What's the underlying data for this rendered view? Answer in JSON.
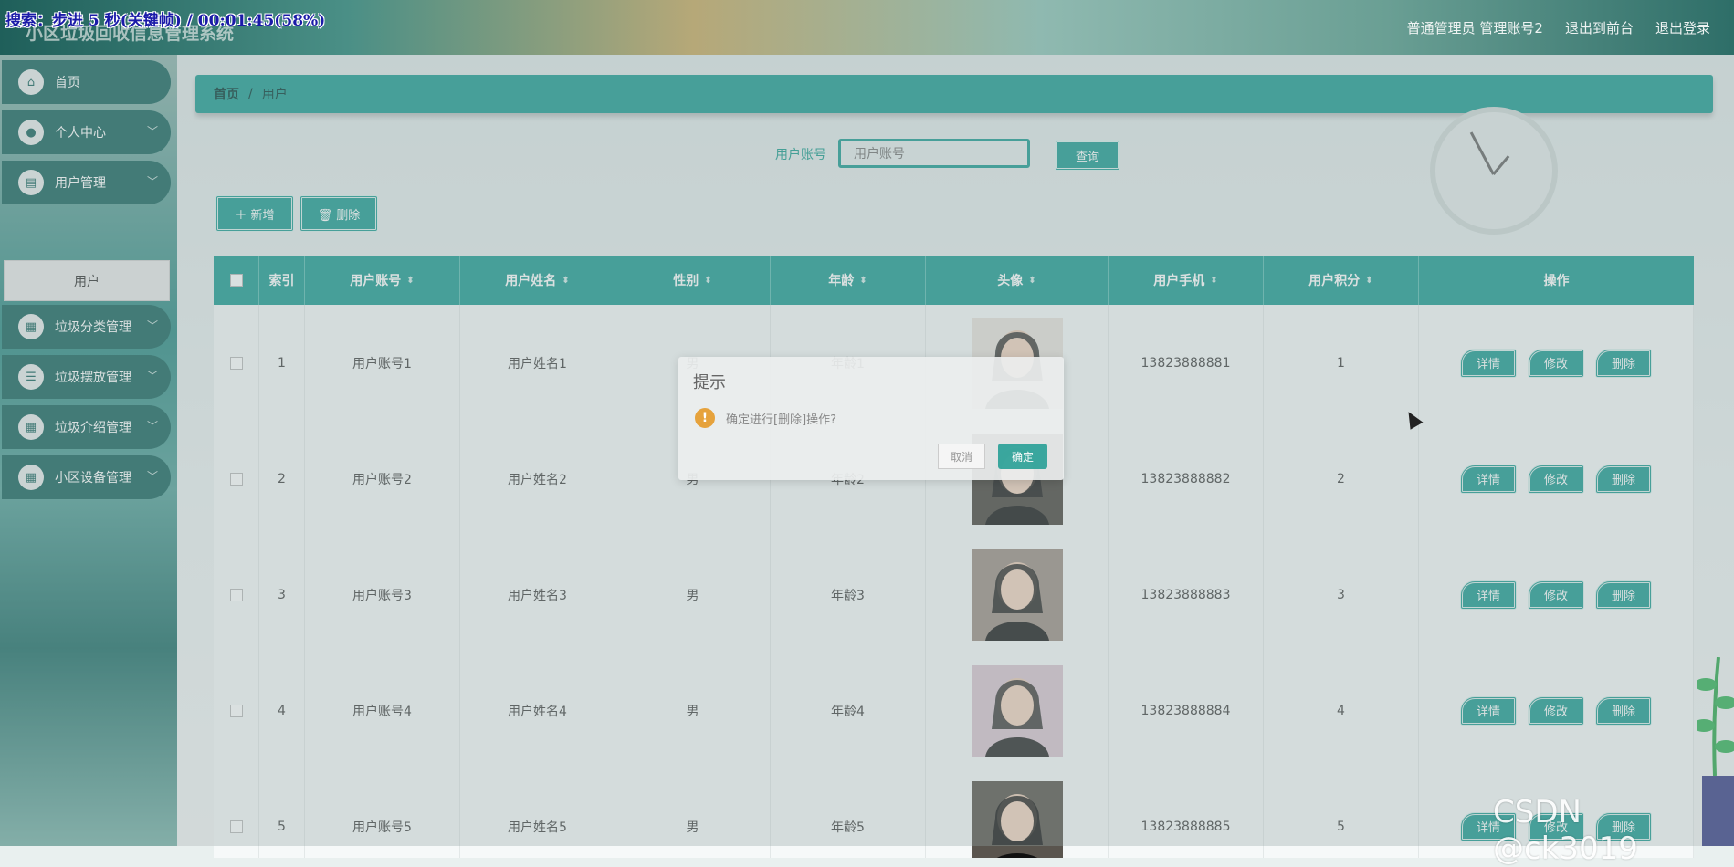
{
  "overlay_caption": "搜索：步进 5 秒(关键帧) / 00:01:45(58%)",
  "header": {
    "title": "小区垃圾回收信息管理系统",
    "links": [
      "普通管理员 管理账号2",
      "退出到前台",
      "退出登录"
    ]
  },
  "sidebar": {
    "items": [
      {
        "label": "首页",
        "icon": "home-icon"
      },
      {
        "label": "个人中心",
        "icon": "user-icon"
      },
      {
        "label": "用户管理",
        "icon": "clipboard-icon"
      },
      {
        "label": "垃圾分类管理",
        "icon": "grid-icon"
      },
      {
        "label": "垃圾摆放管理",
        "icon": "list-icon"
      },
      {
        "label": "垃圾介绍管理",
        "icon": "grid-icon"
      },
      {
        "label": "小区设备管理",
        "icon": "grid-icon"
      }
    ],
    "submenu_active": "用户"
  },
  "breadcrumb": {
    "home": "首页",
    "separator": "/",
    "current": "用户"
  },
  "search": {
    "label": "用户账号",
    "placeholder": "用户账号",
    "button": "查询"
  },
  "toolbar": {
    "add_label": "＋ 新增",
    "delete_label": "🗑 删除"
  },
  "table": {
    "headers": [
      "索引",
      "用户账号",
      "用户姓名",
      "性别",
      "年龄",
      "头像",
      "用户手机",
      "用户积分",
      "操作"
    ],
    "rows": [
      {
        "index": "1",
        "account": "用户账号1",
        "name": "用户姓名1",
        "gender": "男",
        "age": "年龄1",
        "phone": "13823888881",
        "points": "1"
      },
      {
        "index": "2",
        "account": "用户账号2",
        "name": "用户姓名2",
        "gender": "男",
        "age": "年龄2",
        "phone": "13823888882",
        "points": "2"
      },
      {
        "index": "3",
        "account": "用户账号3",
        "name": "用户姓名3",
        "gender": "男",
        "age": "年龄3",
        "phone": "13823888883",
        "points": "3"
      },
      {
        "index": "4",
        "account": "用户账号4",
        "name": "用户姓名4",
        "gender": "男",
        "age": "年龄4",
        "phone": "13823888884",
        "points": "4"
      },
      {
        "index": "5",
        "account": "用户账号5",
        "name": "用户姓名5",
        "gender": "男",
        "age": "年龄5",
        "phone": "13823888885",
        "points": "5"
      }
    ],
    "row_actions": {
      "detail": "详情",
      "edit": "修改",
      "delete": "删除"
    }
  },
  "dialog": {
    "title": "提示",
    "message": "确定进行[删除]操作?",
    "cancel": "取消",
    "confirm": "确定"
  },
  "watermark": "CSDN @ck3019",
  "colors": {
    "primary": "#1e9c92",
    "sidebar_item": "#17655f",
    "warning": "#e6a23c"
  }
}
